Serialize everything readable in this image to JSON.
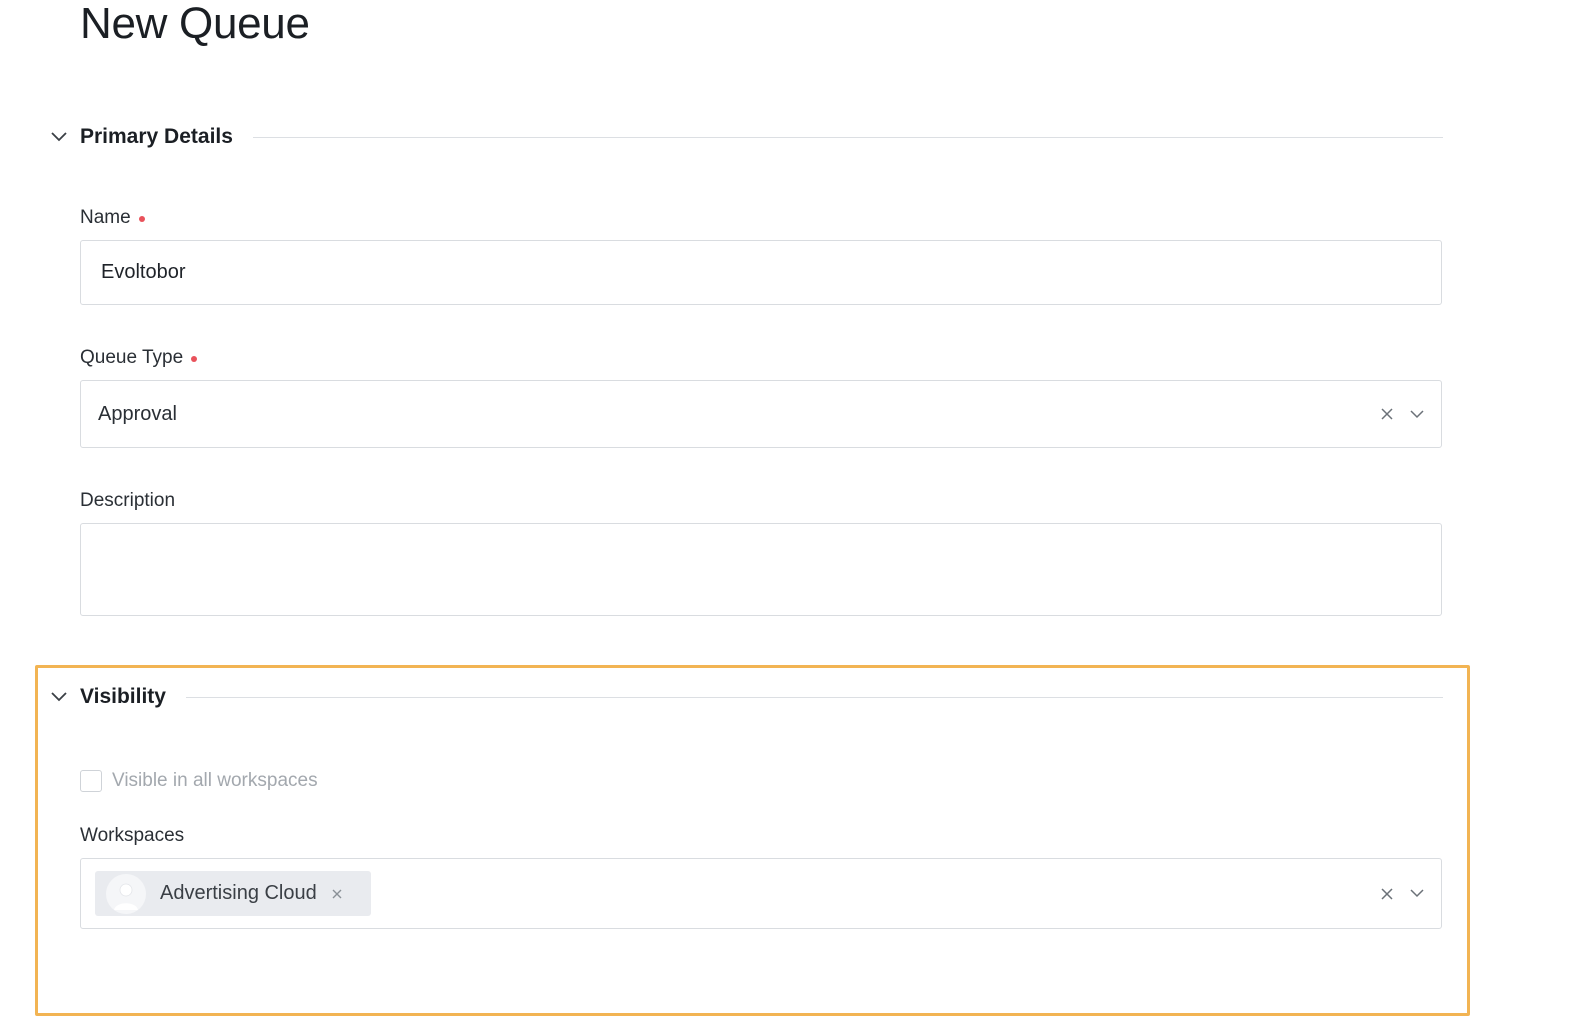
{
  "page": {
    "title": "New Queue"
  },
  "sections": {
    "primary": {
      "title": "Primary Details"
    },
    "visibility": {
      "title": "Visibility"
    }
  },
  "fields": {
    "name": {
      "label": "Name",
      "value": "Evoltobor",
      "required": true
    },
    "queue_type": {
      "label": "Queue Type",
      "value": "Approval",
      "required": true
    },
    "description": {
      "label": "Description",
      "value": ""
    },
    "visible_all": {
      "label": "Visible in all workspaces",
      "checked": false,
      "disabled": true
    },
    "workspaces": {
      "label": "Workspaces",
      "selected": [
        "Advertising Cloud"
      ]
    }
  },
  "colors": {
    "required": "#e9525b",
    "highlight": "#f2b453",
    "border": "#d9dce0"
  },
  "icons": {
    "collapse": "chevron-down-icon",
    "clear": "close-icon",
    "dropdown": "chevron-down-icon",
    "avatar": "user-avatar-icon"
  }
}
